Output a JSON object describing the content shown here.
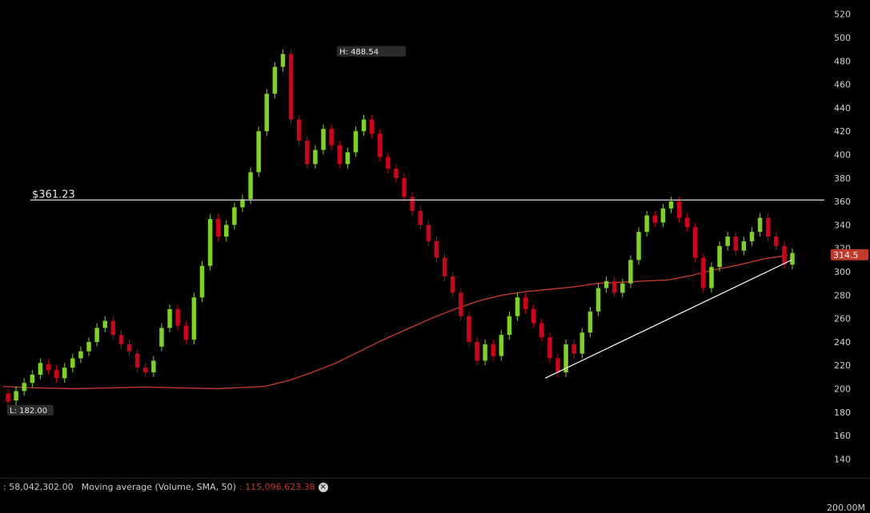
{
  "chart_data": {
    "type": "candlestick",
    "y_axis": {
      "ticks": [
        140,
        160,
        180,
        200,
        220,
        240,
        260,
        280,
        300,
        320,
        340,
        360,
        380,
        400,
        420,
        440,
        460,
        480,
        500,
        520
      ],
      "min": 128,
      "max": 528,
      "position": "right"
    },
    "high_label": "H: 488.54",
    "low_label": "L: 182.00",
    "high_value": 488.54,
    "low_value": 182.0,
    "horizontal_line": {
      "label": "$361.23",
      "value": 361.23
    },
    "last_price_label": "314.5",
    "last_price": 314.5,
    "moving_average_200": [
      202,
      201,
      200.5,
      200,
      200.5,
      201,
      201.5,
      201,
      200.5,
      200,
      201,
      202,
      207,
      214,
      222,
      232,
      242,
      251,
      260,
      268,
      275,
      280,
      283,
      285,
      287,
      290,
      291,
      292,
      293,
      297,
      302,
      306,
      311,
      314
    ],
    "trendline": {
      "from_index": 0.66,
      "to_index": 0.96,
      "from": 209,
      "to": 310
    },
    "candles": [
      [
        196,
        189
      ],
      [
        190,
        198
      ],
      [
        198,
        205
      ],
      [
        205,
        212
      ],
      [
        212,
        222
      ],
      [
        221,
        216
      ],
      [
        216,
        209
      ],
      [
        209,
        218
      ],
      [
        218,
        226
      ],
      [
        226,
        232
      ],
      [
        232,
        240
      ],
      [
        240,
        252
      ],
      [
        252,
        258
      ],
      [
        258,
        246
      ],
      [
        246,
        238
      ],
      [
        238,
        232
      ],
      [
        230,
        218
      ],
      [
        218,
        214
      ],
      [
        214,
        224
      ],
      [
        236,
        252
      ],
      [
        252,
        268
      ],
      [
        268,
        254
      ],
      [
        254,
        242
      ],
      [
        242,
        278
      ],
      [
        278,
        305
      ],
      [
        305,
        345
      ],
      [
        345,
        330
      ],
      [
        330,
        340
      ],
      [
        340,
        355
      ],
      [
        355,
        362
      ],
      [
        362,
        385
      ],
      [
        385,
        420
      ],
      [
        420,
        452
      ],
      [
        452,
        475
      ],
      [
        475,
        486
      ],
      [
        486,
        430
      ],
      [
        430,
        412
      ],
      [
        412,
        392
      ],
      [
        392,
        404
      ],
      [
        404,
        422
      ],
      [
        422,
        408
      ],
      [
        408,
        392
      ],
      [
        392,
        402
      ],
      [
        402,
        420
      ],
      [
        420,
        430
      ],
      [
        430,
        418
      ],
      [
        418,
        398
      ],
      [
        398,
        388
      ],
      [
        388,
        380
      ],
      [
        380,
        364
      ],
      [
        364,
        352
      ],
      [
        352,
        340
      ],
      [
        340,
        326
      ],
      [
        326,
        312
      ],
      [
        312,
        296
      ],
      [
        296,
        282
      ],
      [
        282,
        262
      ],
      [
        262,
        240
      ],
      [
        240,
        224
      ],
      [
        224,
        238
      ],
      [
        238,
        228
      ],
      [
        228,
        246
      ],
      [
        246,
        262
      ],
      [
        262,
        278
      ],
      [
        278,
        268
      ],
      [
        268,
        256
      ],
      [
        256,
        244
      ],
      [
        244,
        226
      ],
      [
        226,
        214
      ],
      [
        214,
        238
      ],
      [
        238,
        230
      ],
      [
        230,
        248
      ],
      [
        248,
        266
      ],
      [
        266,
        286
      ],
      [
        286,
        292
      ],
      [
        292,
        282
      ],
      [
        282,
        290
      ],
      [
        290,
        310
      ],
      [
        310,
        334
      ],
      [
        334,
        348
      ],
      [
        348,
        342
      ],
      [
        342,
        354
      ],
      [
        354,
        360
      ],
      [
        360,
        346
      ],
      [
        346,
        338
      ],
      [
        338,
        312
      ],
      [
        312,
        286
      ],
      [
        286,
        304
      ],
      [
        304,
        322
      ],
      [
        322,
        330
      ],
      [
        330,
        318
      ],
      [
        318,
        326
      ],
      [
        326,
        334
      ],
      [
        334,
        346
      ],
      [
        346,
        330
      ],
      [
        330,
        322
      ],
      [
        322,
        306
      ],
      [
        306,
        316
      ]
    ]
  },
  "volume_panel": {
    "volume_label": ": 58,042,302.00",
    "ma_label": "Moving average (Volume, SMA, 50)",
    "ma_value": ": 115,096,623.38",
    "close_glyph": "×",
    "axis_label": "200.00M"
  },
  "colors": {
    "up": "#7ed321",
    "down": "#d0021b",
    "ma": "#c0392b",
    "line": "#c8c8c8",
    "trend": "#ffffff",
    "last_badge": "#c0392b"
  }
}
